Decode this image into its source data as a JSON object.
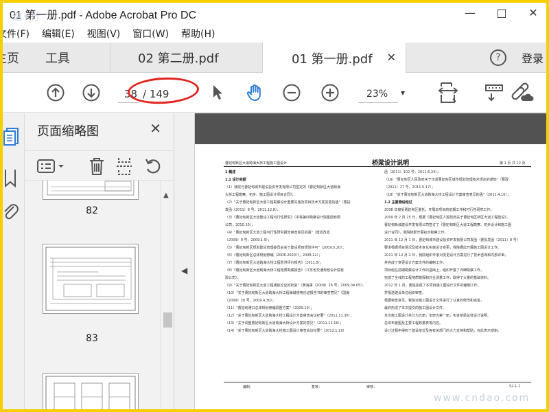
{
  "window": {
    "title": "01 第一册.pdf - Adobe Acrobat Pro DC",
    "watermark_top": "道•行",
    "minimize": "—",
    "maximize": "□",
    "close": "✕"
  },
  "menu": [
    "文件(F)",
    "编辑(E)",
    "视图(V)",
    "窗口(W)",
    "帮助(H)"
  ],
  "tabs": {
    "home": "主页",
    "tools": "工具",
    "doc2": "02 第二册.pdf",
    "doc1": "01 第一册.pdf",
    "doc1_close": "✕",
    "help": "?",
    "login": "登录"
  },
  "toolbar": {
    "page_current": "38",
    "page_total": "/ 149",
    "zoom": "23%",
    "zoom_caret": "▾"
  },
  "panel": {
    "title": "页面缩略图",
    "close": "✕",
    "thumb_labels": [
      "82",
      "83"
    ]
  },
  "document": {
    "header_left": "曹妃甸新区大道跨海大桥工程施工图设计",
    "header_mid": "桥梁设计说明",
    "header_right": "第 1 页 共 12 页",
    "left_column": [
      {
        "text": "1 概述",
        "bold": true
      },
      {
        "text": "1.1 设计依据",
        "bold": true
      },
      {
        "text": "（1）我院与曹妃甸城市建设投资开发有限公司签定的《曹妃甸新区大道跨海",
        "bold": false
      },
      {
        "text": "大桥工程勘察、初步、施工图设计项目合同》；",
        "bold": false
      },
      {
        "text": "（2）\"关于曹妃甸新区大道工程勘察设计重要实施及项目技术方案变更的函\"（曹投",
        "bold": false
      },
      {
        "text": "发函〔2011〕8 号，2011.12.8）；",
        "bold": false
      },
      {
        "text": "（3）《曹妃甸新区大道建设工程可行性研究》（中铁第四勘察设计院集团有限",
        "bold": false
      },
      {
        "text": "公司，2010.10）；",
        "bold": false
      },
      {
        "text": "（4）\"曹妃甸新区大道工程可行性研究报告审查意见的函\"（唐发改发",
        "bold": false
      },
      {
        "text": "〔2009〕9 号，2009.1.9）；",
        "bold": false
      },
      {
        "text": "（5）\"曹妃甸新区规划建设管理委员会关于建设项目规划许可\"（2009.5.20）；",
        "bold": false
      },
      {
        "text": "（6）《曹妃甸新区总体规划修编（2008-2020）》，2008.12）；",
        "bold": false
      },
      {
        "text": "（7）《曹妃甸新区大道跨海大桥工程防洪评价报告》（2011.5）；",
        "bold": false
      },
      {
        "text": "（8）《曹妃甸新区大道跨海大桥工程地质勘察报告》（江苏省交通规划设计院有",
        "bold": false
      },
      {
        "text": "限公司）；",
        "bold": false
      },
      {
        "text": "（9）\"关于曹妃甸新区大道工程通航论证的批复\"（冀海事〔2009〕26 号，2009.04.05）；",
        "bold": false
      },
      {
        "text": "（10）\"关于曹妃甸新区大道跨海大桥工程海域使用论证报告书的审查意见\"（国海",
        "bold": false
      },
      {
        "text": "〔2009〕20 号，2009.4.30）；",
        "bold": false
      },
      {
        "text": "（11）\"曹妃甸港口总体规划修编调整方案\"（2009.10）；",
        "bold": false
      },
      {
        "text": "（12）\"关于曹妃甸新区大道跨海大桥工程设计方案审查会议纪要\"（2011.11.30）；",
        "bold": false
      },
      {
        "text": "（13）\"关于调整曹妃甸新区大道跨海大桥设计方案的意见\"（2011.12.16）；",
        "bold": false
      },
      {
        "text": "（14）\"关于曹妃甸新区大道跨海大桥施工图设计审查会议纪要\"（2012.1.19）",
        "bold": false
      }
    ],
    "right_column": [
      {
        "text": "函〔2011〕102 号，2011.6.24）；",
        "bold": false
      },
      {
        "text": "（16）\"曹妃甸区人民政府关于印发曹妃甸区城市规划管理技术规定的通知\"（曹政",
        "bold": false
      },
      {
        "text": "〔2011〕27 号，2011.5.17）；",
        "bold": false
      },
      {
        "text": "（18）\"关于曹妃甸新区大道跨海大桥工程设计方案审查意见的函\"（2012.4.10）；",
        "bold": false
      },
      {
        "text": "1.2 主要测设经过",
        "bold": true
      },
      {
        "text": "2008 年接受曹妃甸区委托，开展本项目的前期工作和可行性研究工作。",
        "bold": false
      },
      {
        "text": "2009 年 2 月 25 日，根据《曹妃甸区人民政府关于曹妃甸区新区大道工程建设》，",
        "bold": false
      },
      {
        "text": "曹妃甸新城建设开发有限公司签订了《曹妃甸新区大道工程勘察、初步设计和施工图",
        "bold": false
      },
      {
        "text": "设计合同》，我院随即开展初步勘察工作。",
        "bold": false
      },
      {
        "text": "2011 年 12 月 1 日，曹妃甸城市建设投资开发有限公司发函（曹投发函〔2011〕8 号）",
        "bold": false
      },
      {
        "text": "要求根据项目情况及技术变化实施设计变更，我院据此开展施工图设计工作。",
        "bold": false
      },
      {
        "text": "2011 年 12 月 2 日，我院组织专家对变更设计方案进行了技术咨询和内部评审，",
        "bold": false
      },
      {
        "text": "并完成了变更设计方案文件的编制工作。",
        "bold": false
      },
      {
        "text": "项目组在前期勘察设计工作的基础上，组织开展了详细勘察工作，",
        "bold": false
      },
      {
        "text": "完成了全线的工程地质勘探和外业测量工作，取得了大量的基础资料。",
        "bold": false
      },
      {
        "text": "2012 年 1 月，我院完成了本项目施工图设计文件的编制工作，",
        "bold": false
      },
      {
        "text": "并报送建设单位组织审查。",
        "bold": false
      },
      {
        "text": "根据审查意见，我院对施工图设计文件进行了认真的修改和完善，",
        "bold": false
      },
      {
        "text": "最终形成了本次提交的施工图设计文件。",
        "bold": false
      },
      {
        "text": "本次施工图设计共分为五册，本册为第一册，包含桥梁总体设计说明、",
        "bold": false
      },
      {
        "text": "总体布置图及主要工程数量表等内容。",
        "bold": false
      },
      {
        "text": "设计过程中得到了建设单位及各有关部门的大力支持和帮助，在此表示感谢。",
        "bold": false
      }
    ],
    "footer_left": "编制：",
    "footer_mid1": "复核：",
    "footer_mid2": "审核：",
    "footer_right": "S2-1-1"
  },
  "watermark_bottom": "www.cndao.com",
  "colors": {
    "highlight_frame": "#f5d000",
    "ellipse": "#e1241e",
    "icon_gray": "#666666",
    "icon_blue": "#2d7cd6"
  },
  "icons": [
    "arrow-up-icon",
    "arrow-down-icon",
    "cursor-icon",
    "hand-icon",
    "zoom-out-icon",
    "zoom-in-icon",
    "fit-page-icon",
    "keyboard-icon",
    "link-cloud-icon",
    "thumbnails-icon",
    "bookmark-icon",
    "attachment-icon",
    "options-icon",
    "trash-icon",
    "extract-icon",
    "rotate-icon"
  ]
}
